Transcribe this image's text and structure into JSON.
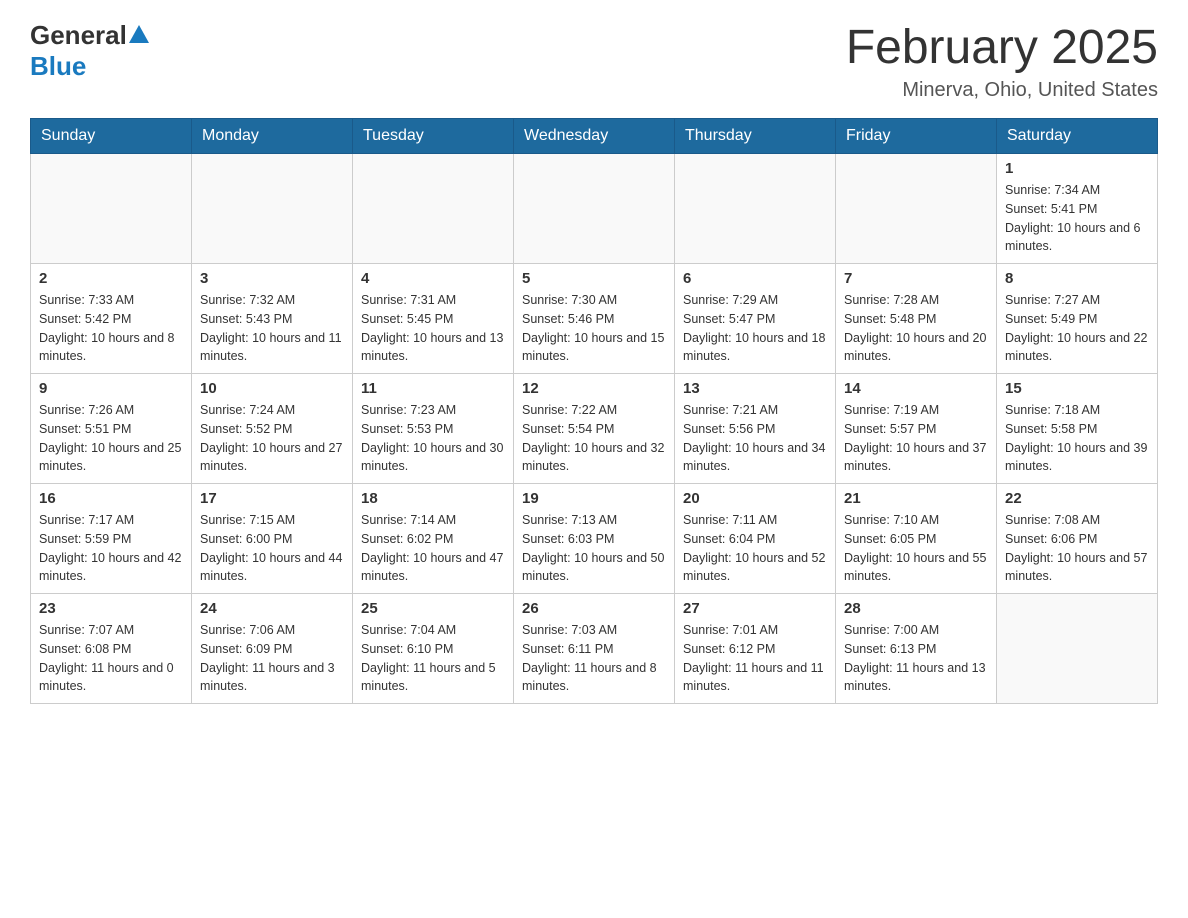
{
  "header": {
    "logo_general": "General",
    "logo_blue": "Blue",
    "title": "February 2025",
    "subtitle": "Minerva, Ohio, United States"
  },
  "days_of_week": [
    "Sunday",
    "Monday",
    "Tuesday",
    "Wednesday",
    "Thursday",
    "Friday",
    "Saturday"
  ],
  "weeks": [
    [
      {
        "day": "",
        "info": ""
      },
      {
        "day": "",
        "info": ""
      },
      {
        "day": "",
        "info": ""
      },
      {
        "day": "",
        "info": ""
      },
      {
        "day": "",
        "info": ""
      },
      {
        "day": "",
        "info": ""
      },
      {
        "day": "1",
        "info": "Sunrise: 7:34 AM\nSunset: 5:41 PM\nDaylight: 10 hours and 6 minutes."
      }
    ],
    [
      {
        "day": "2",
        "info": "Sunrise: 7:33 AM\nSunset: 5:42 PM\nDaylight: 10 hours and 8 minutes."
      },
      {
        "day": "3",
        "info": "Sunrise: 7:32 AM\nSunset: 5:43 PM\nDaylight: 10 hours and 11 minutes."
      },
      {
        "day": "4",
        "info": "Sunrise: 7:31 AM\nSunset: 5:45 PM\nDaylight: 10 hours and 13 minutes."
      },
      {
        "day": "5",
        "info": "Sunrise: 7:30 AM\nSunset: 5:46 PM\nDaylight: 10 hours and 15 minutes."
      },
      {
        "day": "6",
        "info": "Sunrise: 7:29 AM\nSunset: 5:47 PM\nDaylight: 10 hours and 18 minutes."
      },
      {
        "day": "7",
        "info": "Sunrise: 7:28 AM\nSunset: 5:48 PM\nDaylight: 10 hours and 20 minutes."
      },
      {
        "day": "8",
        "info": "Sunrise: 7:27 AM\nSunset: 5:49 PM\nDaylight: 10 hours and 22 minutes."
      }
    ],
    [
      {
        "day": "9",
        "info": "Sunrise: 7:26 AM\nSunset: 5:51 PM\nDaylight: 10 hours and 25 minutes."
      },
      {
        "day": "10",
        "info": "Sunrise: 7:24 AM\nSunset: 5:52 PM\nDaylight: 10 hours and 27 minutes."
      },
      {
        "day": "11",
        "info": "Sunrise: 7:23 AM\nSunset: 5:53 PM\nDaylight: 10 hours and 30 minutes."
      },
      {
        "day": "12",
        "info": "Sunrise: 7:22 AM\nSunset: 5:54 PM\nDaylight: 10 hours and 32 minutes."
      },
      {
        "day": "13",
        "info": "Sunrise: 7:21 AM\nSunset: 5:56 PM\nDaylight: 10 hours and 34 minutes."
      },
      {
        "day": "14",
        "info": "Sunrise: 7:19 AM\nSunset: 5:57 PM\nDaylight: 10 hours and 37 minutes."
      },
      {
        "day": "15",
        "info": "Sunrise: 7:18 AM\nSunset: 5:58 PM\nDaylight: 10 hours and 39 minutes."
      }
    ],
    [
      {
        "day": "16",
        "info": "Sunrise: 7:17 AM\nSunset: 5:59 PM\nDaylight: 10 hours and 42 minutes."
      },
      {
        "day": "17",
        "info": "Sunrise: 7:15 AM\nSunset: 6:00 PM\nDaylight: 10 hours and 44 minutes."
      },
      {
        "day": "18",
        "info": "Sunrise: 7:14 AM\nSunset: 6:02 PM\nDaylight: 10 hours and 47 minutes."
      },
      {
        "day": "19",
        "info": "Sunrise: 7:13 AM\nSunset: 6:03 PM\nDaylight: 10 hours and 50 minutes."
      },
      {
        "day": "20",
        "info": "Sunrise: 7:11 AM\nSunset: 6:04 PM\nDaylight: 10 hours and 52 minutes."
      },
      {
        "day": "21",
        "info": "Sunrise: 7:10 AM\nSunset: 6:05 PM\nDaylight: 10 hours and 55 minutes."
      },
      {
        "day": "22",
        "info": "Sunrise: 7:08 AM\nSunset: 6:06 PM\nDaylight: 10 hours and 57 minutes."
      }
    ],
    [
      {
        "day": "23",
        "info": "Sunrise: 7:07 AM\nSunset: 6:08 PM\nDaylight: 11 hours and 0 minutes."
      },
      {
        "day": "24",
        "info": "Sunrise: 7:06 AM\nSunset: 6:09 PM\nDaylight: 11 hours and 3 minutes."
      },
      {
        "day": "25",
        "info": "Sunrise: 7:04 AM\nSunset: 6:10 PM\nDaylight: 11 hours and 5 minutes."
      },
      {
        "day": "26",
        "info": "Sunrise: 7:03 AM\nSunset: 6:11 PM\nDaylight: 11 hours and 8 minutes."
      },
      {
        "day": "27",
        "info": "Sunrise: 7:01 AM\nSunset: 6:12 PM\nDaylight: 11 hours and 11 minutes."
      },
      {
        "day": "28",
        "info": "Sunrise: 7:00 AM\nSunset: 6:13 PM\nDaylight: 11 hours and 13 minutes."
      },
      {
        "day": "",
        "info": ""
      }
    ]
  ]
}
